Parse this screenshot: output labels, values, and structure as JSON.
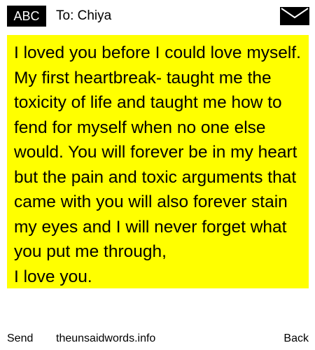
{
  "header": {
    "badge_label": "ABC",
    "recipient": "To: Chiya",
    "envelope_icon": "envelope-icon"
  },
  "message": {
    "background_color": "#ffff00",
    "text": "I loved you before I could love myself. My first heartbreak- taught me the toxicity of life and taught me how to fend for myself when no one else would. You will forever be in my heart but the pain and toxic arguments that came with you will also forever stain my eyes and I will never forget what you put me through,\nI love you."
  },
  "footer": {
    "send_label": "Send",
    "site_label": "theunsaidwords.info",
    "back_label": "Back"
  }
}
